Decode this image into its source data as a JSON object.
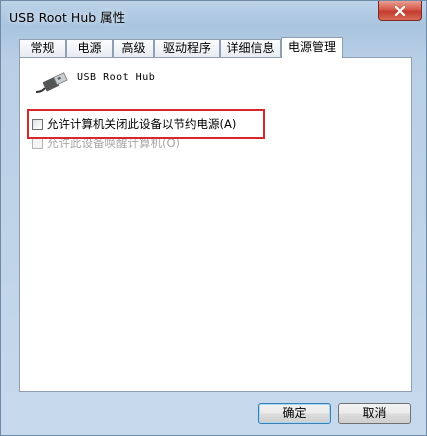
{
  "window": {
    "title": "USB Root Hub 属性"
  },
  "tabs": [
    {
      "label": "常规"
    },
    {
      "label": "电源"
    },
    {
      "label": "高级"
    },
    {
      "label": "驱动程序"
    },
    {
      "label": "详细信息"
    },
    {
      "label": "电源管理",
      "active": true
    }
  ],
  "device": {
    "name": "USB Root Hub",
    "icon": "usb-connector-icon"
  },
  "options": [
    {
      "label": "允许计算机关闭此设备以节约电源(A)",
      "checked": false,
      "enabled": true
    },
    {
      "label": "允许此设备唤醒计算机(O)",
      "checked": false,
      "enabled": false
    }
  ],
  "buttons": {
    "ok": "确定",
    "cancel": "取消"
  },
  "colors": {
    "highlight": "#d6282a",
    "close": "#c23b2f"
  }
}
